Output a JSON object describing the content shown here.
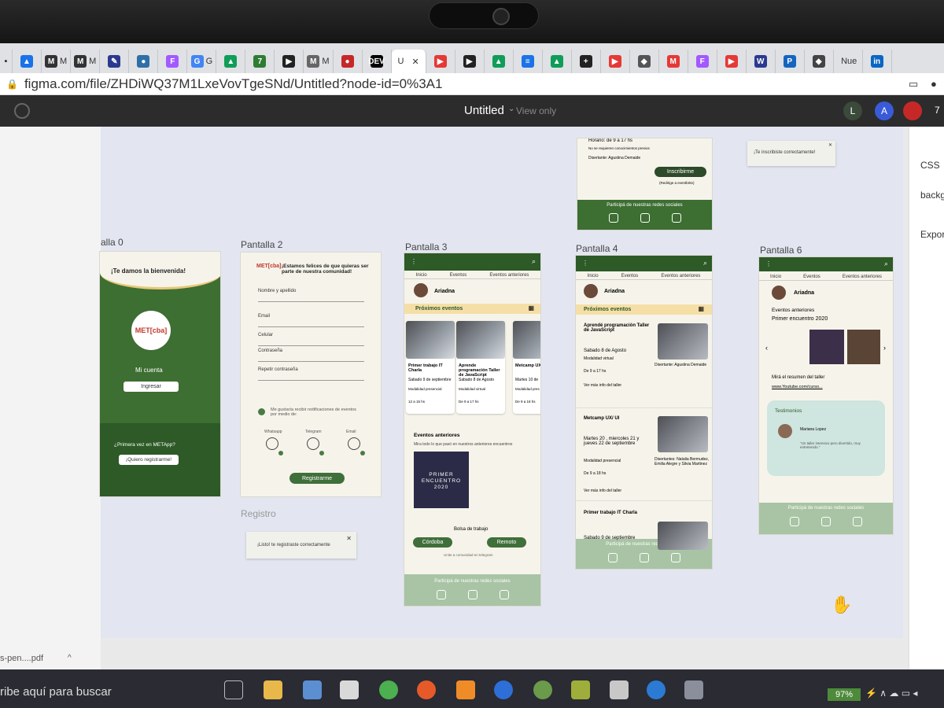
{
  "browser": {
    "tabs": [
      {
        "label": "",
        "color": "#1a73e8",
        "glyph": "▲"
      },
      {
        "label": "M",
        "color": "#333",
        "glyph": "M"
      },
      {
        "label": "M",
        "color": "#333",
        "glyph": "M"
      },
      {
        "label": "",
        "color": "#2b3a8f",
        "glyph": "✎"
      },
      {
        "label": "",
        "color": "#2f6fa8",
        "glyph": "●"
      },
      {
        "label": "",
        "color": "#a259ff",
        "glyph": "F"
      },
      {
        "label": "G",
        "color": "#4285f4",
        "glyph": "G"
      },
      {
        "label": "",
        "color": "#0f9d58",
        "glyph": "▲"
      },
      {
        "label": "",
        "color": "#2e7d32",
        "glyph": "7"
      },
      {
        "label": "",
        "color": "#222",
        "glyph": "▶"
      },
      {
        "label": "M",
        "color": "#666",
        "glyph": "M"
      },
      {
        "label": "",
        "color": "#c62828",
        "glyph": "●"
      },
      {
        "label": "",
        "color": "#000",
        "glyph": "DEV"
      }
    ],
    "active_tab": {
      "label": "U",
      "close": "✕"
    },
    "tabs_right": [
      {
        "label": "",
        "color": "#e53935",
        "glyph": "▶"
      },
      {
        "label": "",
        "color": "#222",
        "glyph": "▶"
      },
      {
        "label": "",
        "color": "#0f9d58",
        "glyph": "▲"
      },
      {
        "label": "",
        "color": "#1a73e8",
        "glyph": "≡"
      },
      {
        "label": "",
        "color": "#0f9d58",
        "glyph": "▲"
      },
      {
        "label": "",
        "color": "#222",
        "glyph": "+"
      },
      {
        "label": "",
        "color": "#e53935",
        "glyph": "▶"
      },
      {
        "label": "",
        "color": "#555",
        "glyph": "◆"
      },
      {
        "label": "",
        "color": "#e53935",
        "glyph": "M"
      },
      {
        "label": "",
        "color": "#a259ff",
        "glyph": "F"
      },
      {
        "label": "",
        "color": "#e53935",
        "glyph": "▶"
      },
      {
        "label": "",
        "color": "#2b3a8f",
        "glyph": "W"
      },
      {
        "label": "",
        "color": "#1565c0",
        "glyph": "P"
      },
      {
        "label": "",
        "color": "#444",
        "glyph": "◆"
      },
      {
        "label": "Nue",
        "color": "",
        "glyph": ""
      },
      {
        "label": "",
        "color": "#0a66c2",
        "glyph": "in"
      }
    ],
    "url": "figma.com/file/ZHDiWQ37M1LxeVovTgeSNd/Untitled?node-id=0%3A1"
  },
  "figma": {
    "file_title": "Untitled",
    "view_mode": "View only",
    "avatars": [
      {
        "initial": "L",
        "color": "#3b4a3b"
      },
      {
        "initial": "A",
        "color": "#3a5bd9"
      },
      {
        "initial": "",
        "color": "#c62828"
      }
    ],
    "avatar_count": "7",
    "right_panel": {
      "css": "CSS",
      "background": "backg",
      "export": "Expor"
    }
  },
  "frames": {
    "pantalla0": {
      "label": "alla 0",
      "welcome": "¡Te damos la bienvenida!",
      "logo": "MET[cba]",
      "my_account": "Mi cuenta",
      "login_button": "Ingresar",
      "first_time": "¿Primera vez en METApp?",
      "register_button": "¡Quiero registrarme!"
    },
    "pantalla2": {
      "label": "Pantalla 2",
      "logo": "MET[cba]",
      "heading": "¡Estamos felices de que quieras ser parte de nuestra comunidad!",
      "fields": [
        "Nombre y apellido",
        "Email",
        "Celular",
        "Contraseña",
        "Repetir contraseña"
      ],
      "notify_text": "Me gustaría recibir notificaciones de eventos por medio de:",
      "channels": [
        "Whatsapp",
        "Telegram",
        "Email"
      ],
      "register_button": "Registrarme"
    },
    "registro": {
      "label": "Registro",
      "toast": "¡Listo! te registraste correctamente",
      "close": "✕"
    },
    "pantalla3": {
      "label": "Pantalla 3",
      "tabs": [
        "Inicio",
        "Eventos",
        "Eventos anteriores"
      ],
      "user": "Ariadna",
      "upcoming": "Próximos eventos",
      "cards": [
        {
          "title": "Primer trabajo IT Charla",
          "date": "Sabado 9 de septiembre",
          "mode": "Modalidad presencial",
          "time": "12 a 15 hs"
        },
        {
          "title": "Aprende programación Taller de JavaScript",
          "date": "Sabado 8 de Agosto",
          "mode": "Modalidad virtual",
          "time": "De 9 a 17 hs"
        },
        {
          "title": "Metcamp UX/UI",
          "date": "Martes 10 de",
          "mode": "Modalidad pres",
          "time": "De 9 a 18 hs"
        }
      ],
      "past_title": "Eventos anteriores",
      "past_desc": "Mira todo lo que pasó en nuestros anteriores encuentros",
      "poster_line1": "PRIMER",
      "poster_line2": "ENCUENTRO",
      "poster_line3": "2020",
      "jobs": "Bolsa de trabajo",
      "city_buttons": [
        "Córdoba",
        "Remoto"
      ],
      "telegram": "Unite a comunidad en telegram",
      "social": "Participá de nuestras redes sociales"
    },
    "pantalla4": {
      "label": "Pantalla 4",
      "tabs": [
        "Inicio",
        "Eventos",
        "Eventos anteriores"
      ],
      "user": "Ariadna",
      "upcoming": "Próximos eventos",
      "events": [
        {
          "title": "Aprendé programación Taller de JavaScript",
          "date": "Sabado 8 de Agosto",
          "mode": "Modalidad virtual",
          "time": "De 9 a 17 hs",
          "speakers": "Disertante: Agustina Demaide",
          "more": "Ver más info del taller"
        },
        {
          "title": "Metcamp UX/ UI",
          "date": "Martes 20 , miercoles 21 y jueves 22 de septiembre",
          "mode": "Modalidad presencial",
          "time": "De 9 a 18 hs",
          "speakers": "Disertantes: Natalia Bermudez, Emilia Alegre y Silvia Martinez",
          "more": "Ver más info del taller"
        },
        {
          "title": "Primer trabajo IT Charla",
          "date": "Sabado 9 de septiembre",
          "mode": "",
          "time": "",
          "speakers": "",
          "more": ""
        }
      ],
      "social": "Participá de nuestras redes sociales"
    },
    "pantalla5_top": {
      "schedule": "Horario: de 9 a 17 hs",
      "note": "No se requieren conocimientos previos",
      "speaker": "Disertante: Agustina Demaide",
      "signup": "Inscribirme",
      "redirect": "(Redirige a eventbrite)",
      "social": "Participá de nuestras redes sociales"
    },
    "toast_top": {
      "text": "¡Te inscribiste correctamente!",
      "close": "✕"
    },
    "pantalla6": {
      "label": "Pantalla 6",
      "tabs": [
        "Inicio",
        "Eventos",
        "Eventos anteriores"
      ],
      "user": "Ariadna",
      "past": "Eventos anteriores",
      "event": "Primer encuentro 2020",
      "summary": "Mirá el resumen del taller",
      "link": "www.Youtube.com/curso...",
      "testimonials": "Testimonios",
      "person": "Mariana Lopez",
      "quote": "\"Un taller intensivo pero divertido, muy entretenido.\"",
      "social": "Participá de nuestras redes sociales"
    }
  },
  "downloads": {
    "file": "s-pen....pdf",
    "chevron": "^"
  },
  "taskbar": {
    "search": "ribe aquí para buscar",
    "battery": "97%"
  }
}
